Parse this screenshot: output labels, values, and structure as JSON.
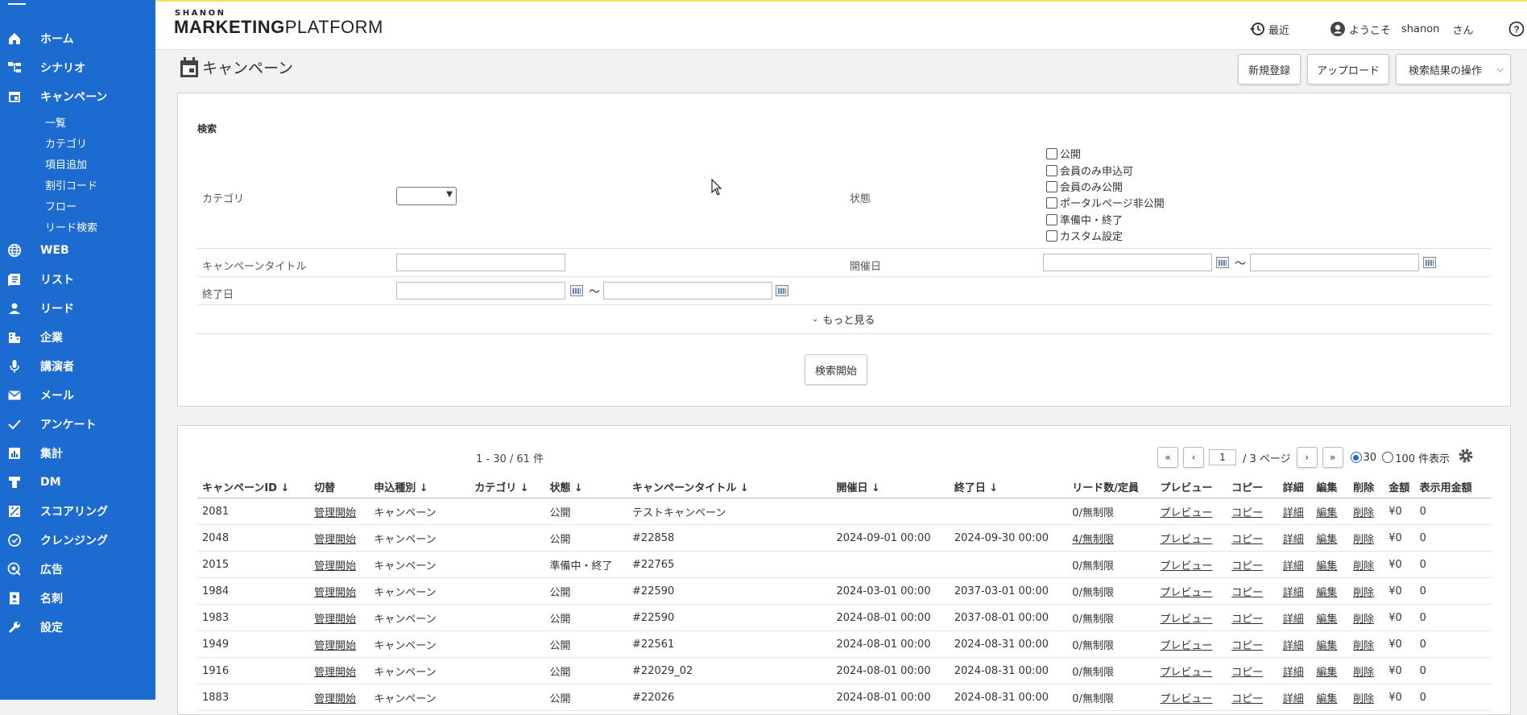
{
  "sidebar": {
    "items": [
      {
        "label": "ホーム",
        "icon": "home-icon"
      },
      {
        "label": "シナリオ",
        "icon": "scenario-icon"
      },
      {
        "label": "キャンペーン",
        "icon": "calendar-icon"
      },
      {
        "label": "WEB",
        "icon": "globe-icon"
      },
      {
        "label": "リスト",
        "icon": "list-icon"
      },
      {
        "label": "リード",
        "icon": "person-icon"
      },
      {
        "label": "企業",
        "icon": "building-icon"
      },
      {
        "label": "講演者",
        "icon": "microphone-icon"
      },
      {
        "label": "メール",
        "icon": "mail-icon"
      },
      {
        "label": "アンケート",
        "icon": "check-icon"
      },
      {
        "label": "集計",
        "icon": "chart-icon"
      },
      {
        "label": "DM",
        "icon": "dm-icon"
      },
      {
        "label": "スコアリング",
        "icon": "scoring-icon"
      },
      {
        "label": "クレンジング",
        "icon": "cleansing-icon"
      },
      {
        "label": "広告",
        "icon": "ad-icon"
      },
      {
        "label": "名刺",
        "icon": "card-icon"
      },
      {
        "label": "設定",
        "icon": "wrench-icon"
      }
    ],
    "subitems": [
      "一覧",
      "カテゴリ",
      "項目追加",
      "割引コード",
      "フロー",
      "リード検索"
    ]
  },
  "header": {
    "logo_small": "SHANON",
    "logo_bold": "MARKETING",
    "logo_light": "PLATFORM",
    "recent": "最近",
    "welcome": "ようこそ",
    "username": "shanon",
    "honorific": "さん"
  },
  "page": {
    "title": "キャンペーン",
    "new_button": "新規登録",
    "upload_button": "アップロード",
    "actions_select": "検索結果の操作"
  },
  "search": {
    "heading": "検索",
    "category_label": "カテゴリ",
    "status_label": "状態",
    "status_options": [
      "公開",
      "会員のみ申込可",
      "会員のみ公開",
      "ポータルページ非公開",
      "準備中・終了",
      "カスタム設定"
    ],
    "title_label": "キャンペーンタイトル",
    "start_label": "開催日",
    "end_label": "終了日",
    "tilde": "～",
    "more": "もっと見る",
    "submit": "検索開始"
  },
  "results": {
    "count": "1 - 30 / 61 件",
    "first": "«",
    "prev": "‹",
    "page": "1",
    "pages": "/ 3 ページ",
    "next": "›",
    "last": "»",
    "per_page_30": "30",
    "per_page_100": "100 件表示",
    "columns": [
      "キャンペーンID ↓",
      "切替",
      "申込種別 ↓",
      "カテゴリ ↓",
      "状態 ↓",
      "キャンペーンタイトル ↓",
      "開催日 ↓",
      "終了日 ↓",
      "リード数/定員",
      "プレビュー",
      "コピー",
      "詳細",
      "編集",
      "削除",
      "金額",
      "表示用金額"
    ],
    "rows": [
      [
        "2081",
        "管理開始",
        "キャンペーン",
        "",
        "公開",
        "テストキャンペーン",
        "",
        "",
        "0/無制限",
        "プレビュー",
        "コピー",
        "詳細",
        "編集",
        "削除",
        "¥0",
        "0"
      ],
      [
        "2048",
        "管理開始",
        "キャンペーン",
        "",
        "公開",
        "#22858",
        "2024-09-01 00:00",
        "2024-09-30 00:00",
        "4/無制限",
        "プレビュー",
        "コピー",
        "詳細",
        "編集",
        "削除",
        "¥0",
        "0"
      ],
      [
        "2015",
        "管理開始",
        "キャンペーン",
        "",
        "準備中・終了",
        "#22765",
        "",
        "",
        "0/無制限",
        "プレビュー",
        "コピー",
        "詳細",
        "編集",
        "削除",
        "¥0",
        "0"
      ],
      [
        "1984",
        "管理開始",
        "キャンペーン",
        "",
        "公開",
        "#22590",
        "2024-03-01 00:00",
        "2037-03-01 00:00",
        "0/無制限",
        "プレビュー",
        "コピー",
        "詳細",
        "編集",
        "削除",
        "¥0",
        "0"
      ],
      [
        "1983",
        "管理開始",
        "キャンペーン",
        "",
        "公開",
        "#22590",
        "2024-08-01 00:00",
        "2037-08-01 00:00",
        "0/無制限",
        "プレビュー",
        "コピー",
        "詳細",
        "編集",
        "削除",
        "¥0",
        "0"
      ],
      [
        "1949",
        "管理開始",
        "キャンペーン",
        "",
        "公開",
        "#22561",
        "2024-08-01 00:00",
        "2024-08-31 00:00",
        "0/無制限",
        "プレビュー",
        "コピー",
        "詳細",
        "編集",
        "削除",
        "¥0",
        "0"
      ],
      [
        "1916",
        "管理開始",
        "キャンペーン",
        "",
        "公開",
        "#22029_02",
        "2024-08-01 00:00",
        "2024-08-31 00:00",
        "0/無制限",
        "プレビュー",
        "コピー",
        "詳細",
        "編集",
        "削除",
        "¥0",
        "0"
      ],
      [
        "1883",
        "管理開始",
        "キャンペーン",
        "",
        "公開",
        "#22026",
        "2024-08-01 00:00",
        "2024-08-31 00:00",
        "0/無制限",
        "プレビュー",
        "コピー",
        "詳細",
        "編集",
        "削除",
        "¥0",
        "0"
      ]
    ]
  }
}
